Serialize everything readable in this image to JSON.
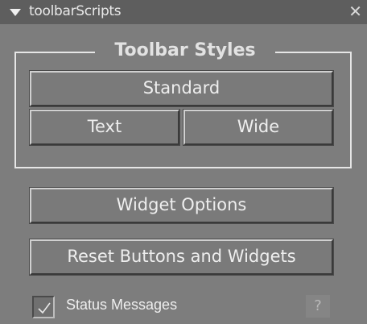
{
  "window": {
    "title": "toolbarScripts",
    "close_glyph": "✕"
  },
  "toolbar_styles": {
    "group_title": "Toolbar Styles",
    "standard_label": "Standard",
    "text_label": "Text",
    "wide_label": "Wide"
  },
  "actions": {
    "widget_options_label": "Widget Options",
    "reset_label": "Reset Buttons and Widgets"
  },
  "status": {
    "label": "Status Messages",
    "checked": true,
    "help_glyph": "?"
  },
  "icons": {
    "collapse": "triangle-down-icon",
    "close": "close-icon",
    "check": "checkmark-icon"
  },
  "colors": {
    "panel": "#7d7d7d",
    "titlebar": "#5e5e5e",
    "text": "#eeeeee"
  }
}
